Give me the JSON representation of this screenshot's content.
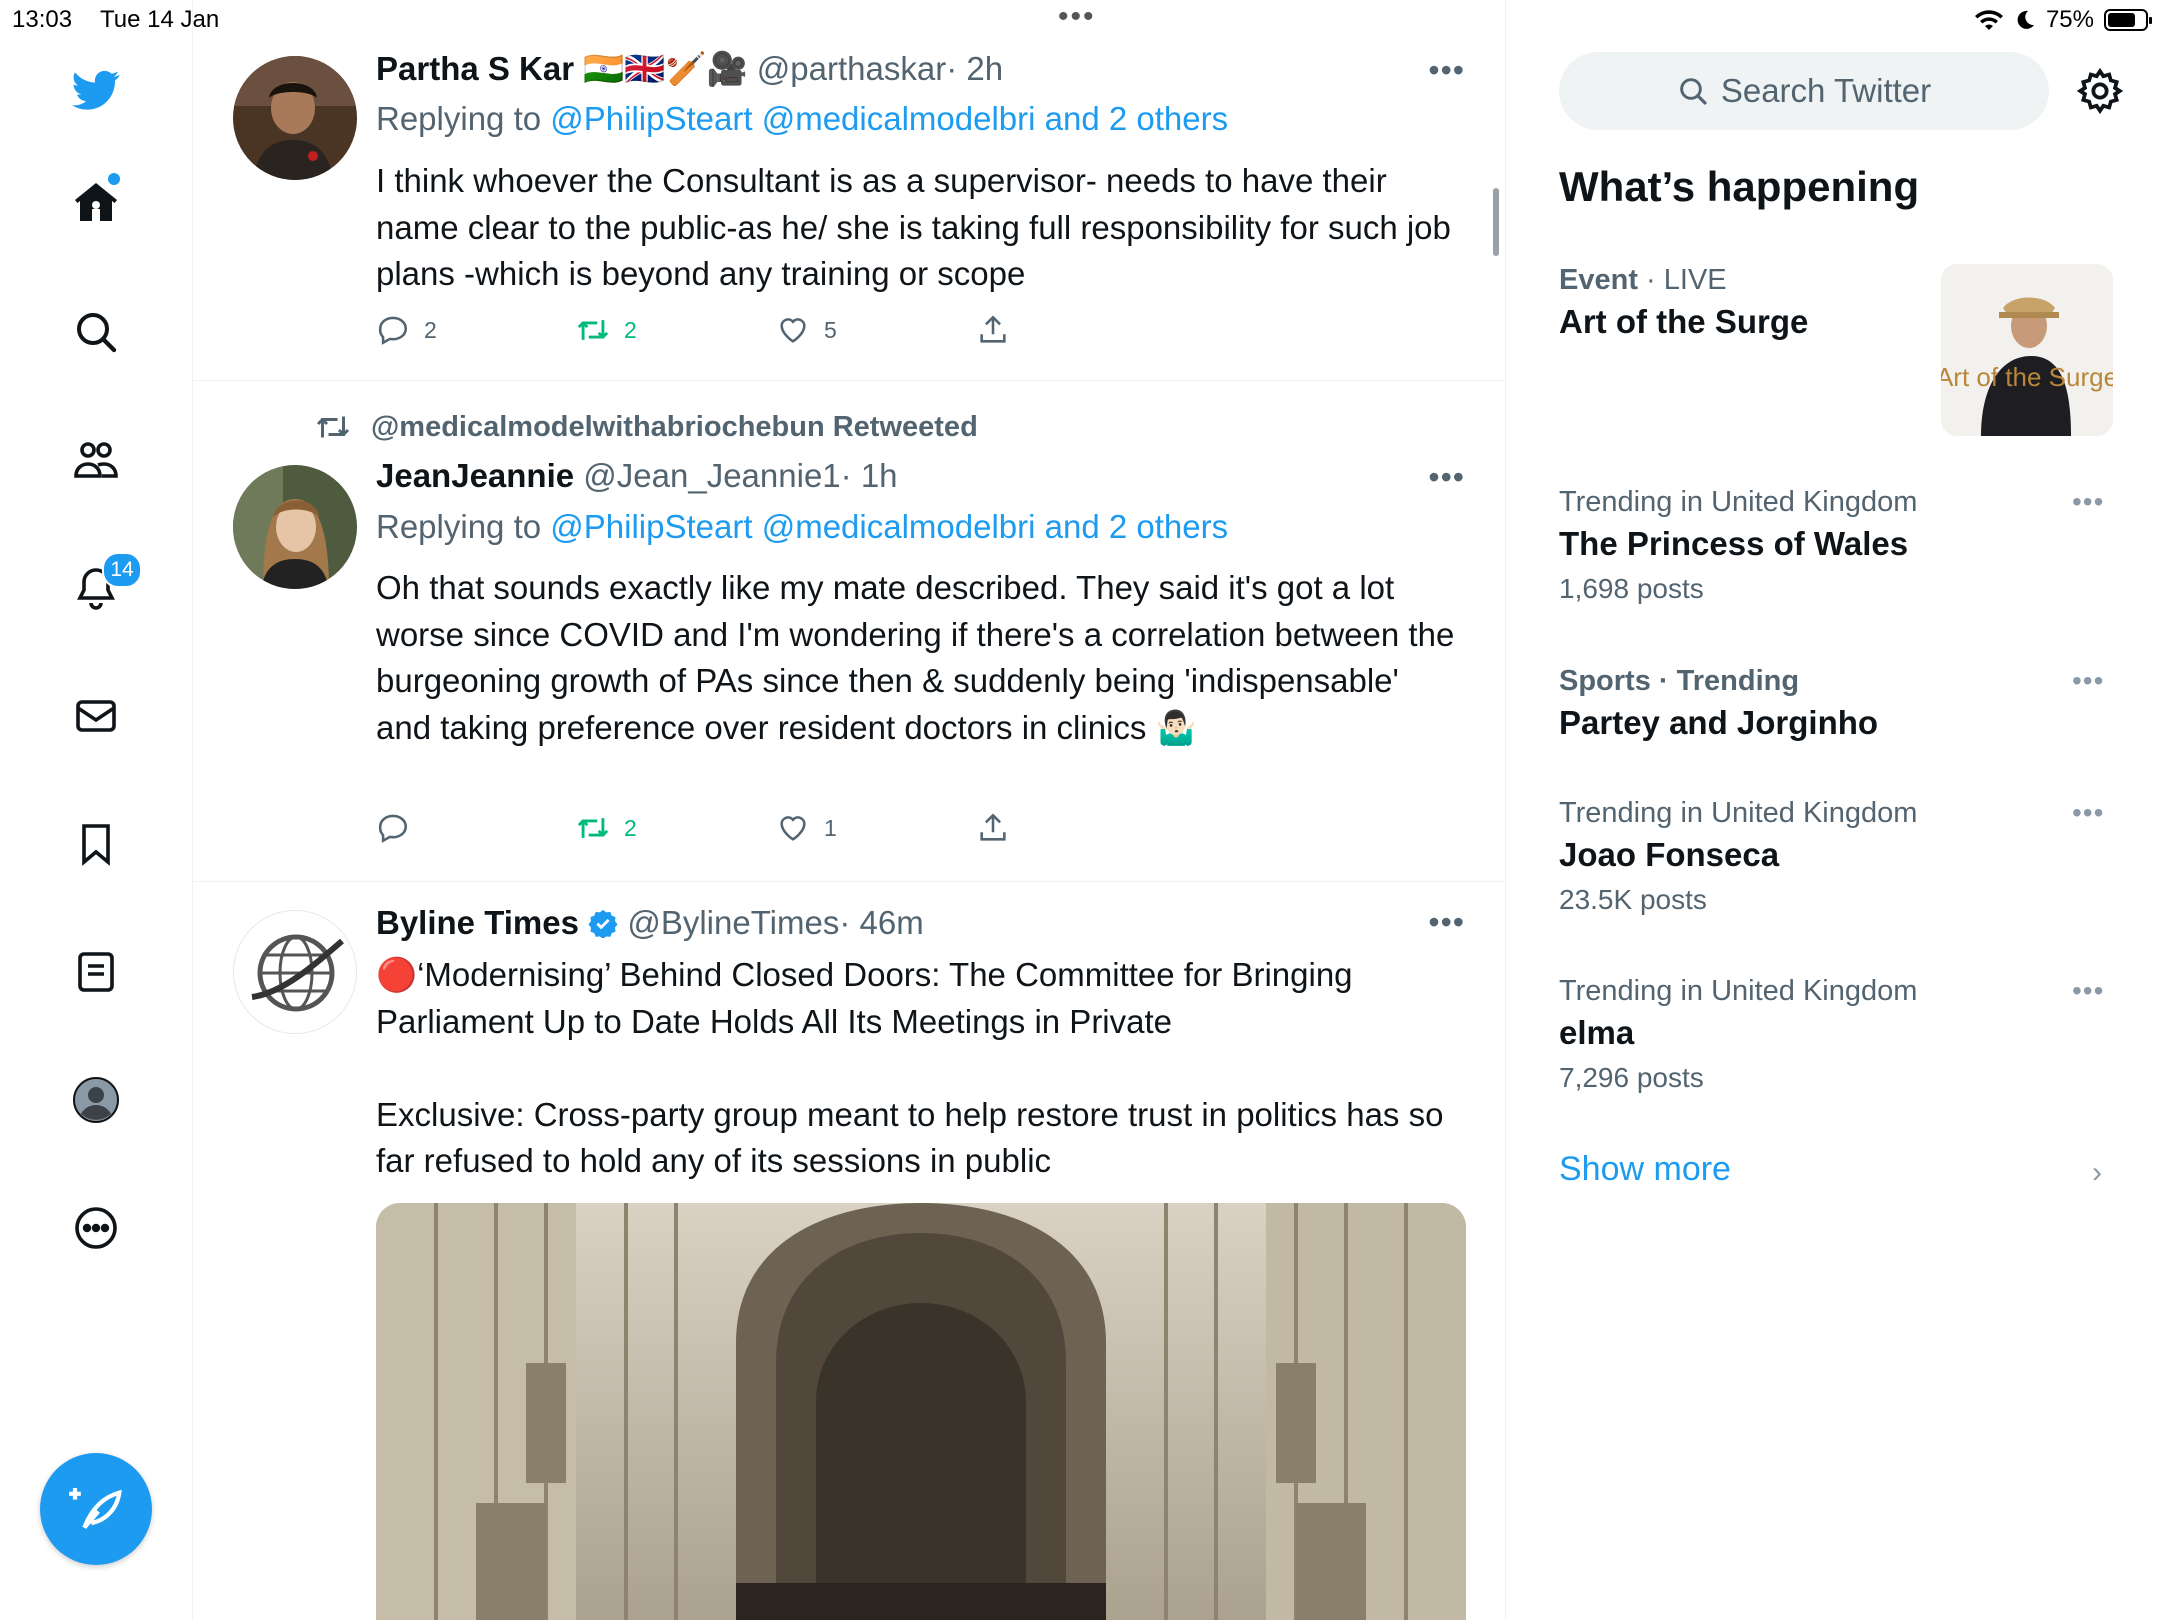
{
  "status_bar": {
    "time": "13:03",
    "date": "Tue 14 Jan",
    "battery": "75%",
    "battery_level": 0.75
  },
  "nav": {
    "notifications_badge": "14",
    "items": [
      "home-icon",
      "search-icon",
      "communities-icon",
      "notifications-icon",
      "messages-icon",
      "bookmarks-icon",
      "lists-icon",
      "profile-icon",
      "more-icon"
    ]
  },
  "tweets": [
    {
      "name": "Partha S Kar",
      "emojis": "🇮🇳🇬🇧🏏🎥",
      "handle": "@parthaskar",
      "time": "· 2h",
      "more": "•••",
      "replying_prefix": "Replying to",
      "replying_to": "@PhilipSteart @medicalmodelbri and 2 others",
      "text": "I think whoever the Consultant is as a supervisor- needs to have their name clear to the public-as he/ she is taking full responsibility for such job plans -which is beyond any training or scope",
      "replies": "2",
      "retweets": "2",
      "likes": "5"
    },
    {
      "retweeted_by": "@medicalmodelwithabriochebun Retweeted",
      "name": "JeanJeannie",
      "handle": "@Jean_Jeannie1",
      "time": "· 1h",
      "more": "•••",
      "replying_prefix": "Replying to",
      "replying_to": "@PhilipSteart @medicalmodelbri and 2 others",
      "text": "Oh that sounds exactly like my mate described. They said it's got a lot worse since COVID and I'm wondering if there's a correlation between the burgeoning growth of PAs since then & suddenly being 'indispensable' and taking preference over resident doctors in clinics 🤷🏻‍♂️",
      "replies": "",
      "retweets": "2",
      "likes": "1"
    },
    {
      "name": "Byline Times",
      "verified": true,
      "handle": "@BylineTimes",
      "time": "· 46m",
      "more": "•••",
      "text": "🔴‘Modernising’ Behind Closed Doors: The Committee for Bringing Parliament Up to Date Holds All Its Meetings in Private\n\nExclusive: Cross-party group meant to help restore trust in politics has so far refused to hold any of its sessions in public"
    }
  ],
  "sidebar": {
    "search_placeholder": "Search Twitter",
    "heading": "What’s happening",
    "event": {
      "category": "Event",
      "status": "· LIVE",
      "title": "Art of the Surge",
      "image_text": "Art of the Surge"
    },
    "trends": [
      {
        "meta": "Trending in United Kingdom",
        "title": "The Princess of Wales",
        "count": "1,698 posts"
      },
      {
        "meta": "Sports · Trending",
        "title": "Partey and Jorginho",
        "count": ""
      },
      {
        "meta": "Trending in United Kingdom",
        "title": "Joao Fonseca",
        "count": "23.5K posts"
      },
      {
        "meta": "Trending in United Kingdom",
        "title": "elma",
        "count": "7,296 posts"
      }
    ],
    "trend_more": "•••",
    "show_more": "Show more",
    "chevron": "›"
  },
  "colors": {
    "accent": "#1d9bf0",
    "retweet": "#00ba7c",
    "secondary_text": "#536471"
  }
}
